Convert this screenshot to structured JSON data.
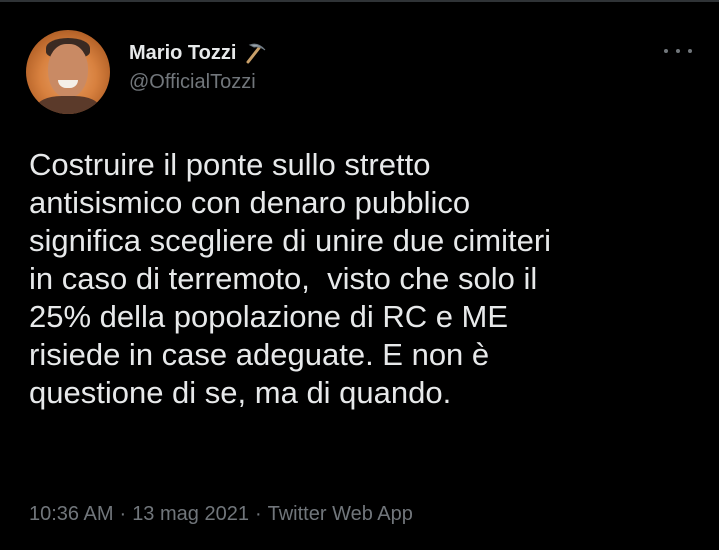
{
  "author": {
    "name": "Mario Tozzi",
    "handle": "@OfficialTozzi",
    "name_emoji": "pickaxe-icon"
  },
  "tweet": {
    "text": "Costruire il ponte sullo stretto\nantisismico con denaro pubblico\nsignifica scegliere di unire due cimiteri\nin caso di terremoto,  visto che solo il\n25% della popolazione di RC e ME\nrisiede in case adeguate. E non è\nquestione di se, ma di quando.",
    "time": "10:36 AM",
    "date": "13 mag 2021",
    "source": "Twitter Web App",
    "separator": "·"
  },
  "colors": {
    "background": "#000000",
    "text": "#e7e9ea",
    "secondary": "#71767b"
  }
}
